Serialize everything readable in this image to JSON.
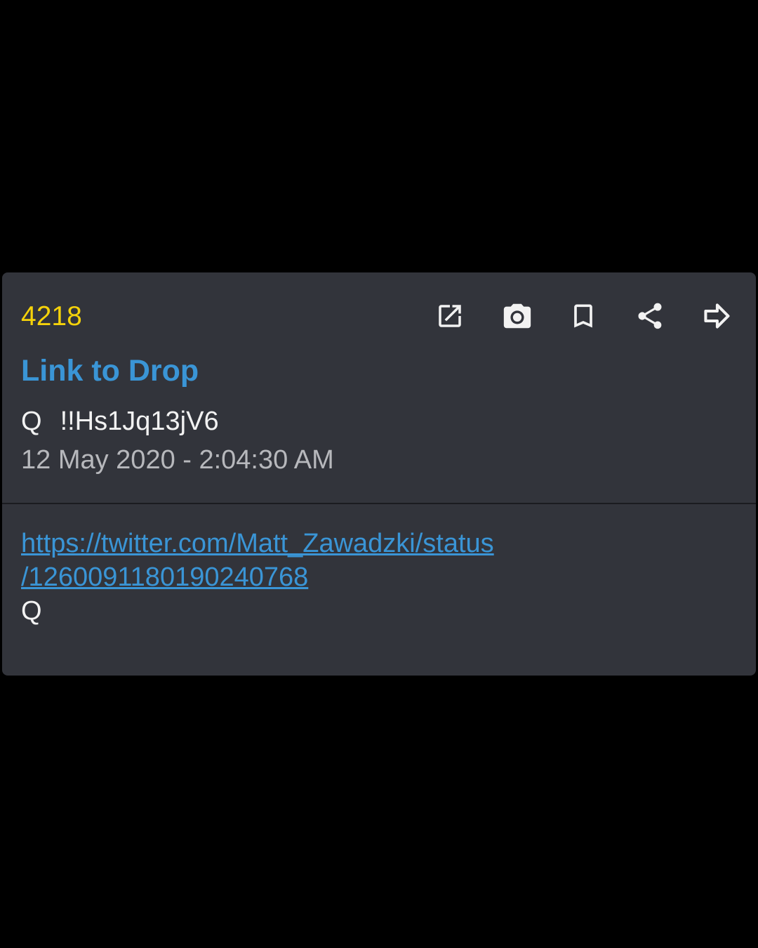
{
  "post": {
    "number": "4218",
    "link_label": "Link to Drop",
    "author": "Q",
    "tripcode": "!!Hs1Jq13jV6",
    "timestamp": "12 May 2020 - 2:04:30 AM",
    "body": {
      "link_line1": "https://twitter.com/Matt_Zawadzki/status",
      "link_line2": "/1260091180190240768",
      "signature": "Q"
    }
  },
  "actions": [
    {
      "icon": "open-in-new-icon"
    },
    {
      "icon": "camera-icon"
    },
    {
      "icon": "bookmark-icon"
    },
    {
      "icon": "share-icon"
    },
    {
      "icon": "forward-arrow-icon"
    }
  ],
  "colors": {
    "background": "#000000",
    "card": "#32343b",
    "post_number": "#f5d20a",
    "link": "#3a95d6",
    "text": "#f2f2f2",
    "muted_text": "#b7b8bc"
  }
}
